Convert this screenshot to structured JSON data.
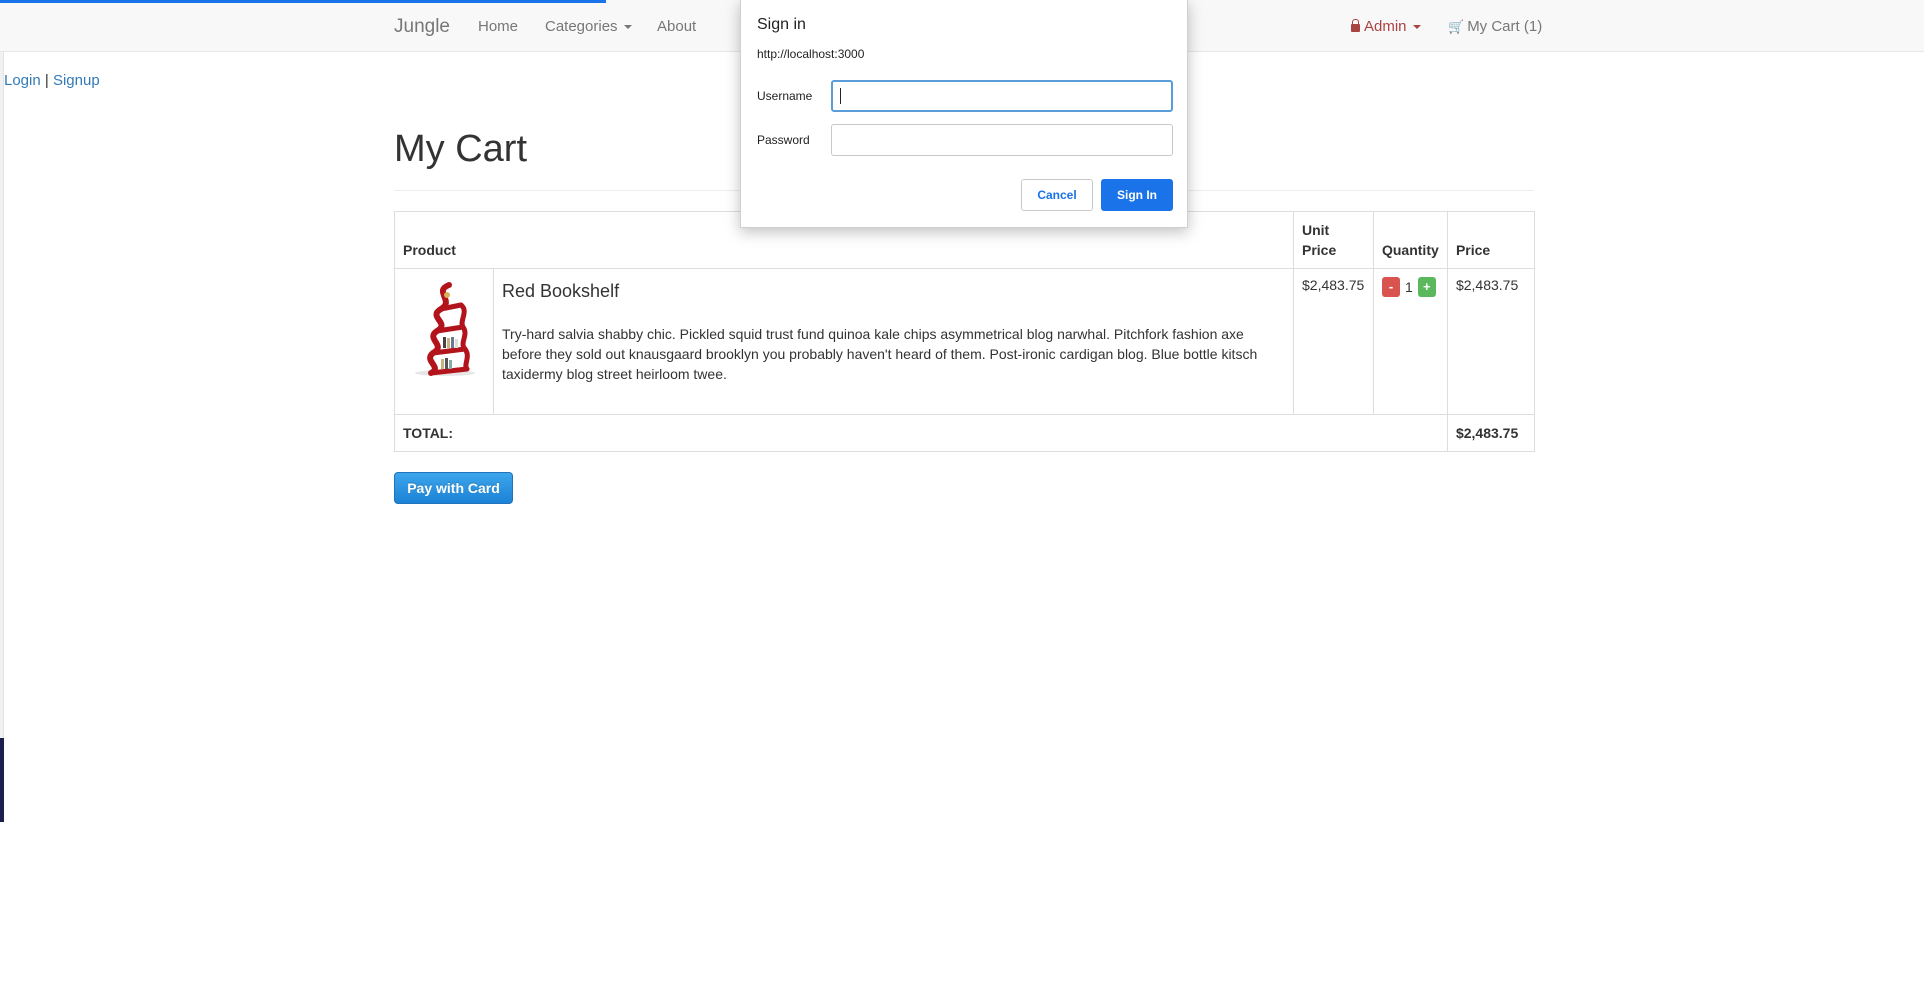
{
  "nav": {
    "brand": "Jungle",
    "home": "Home",
    "categories": "Categories",
    "about": "About",
    "admin": "Admin",
    "cart": "My Cart (1)"
  },
  "auth": {
    "login": "Login",
    "separator": "|",
    "signup": "Signup"
  },
  "page": {
    "title": "My Cart"
  },
  "table": {
    "headers": {
      "product": "Product",
      "unit_price": "Unit Price",
      "quantity": "Quantity",
      "price": "Price"
    },
    "rows": [
      {
        "name": "Red Bookshelf",
        "description": "Try-hard salvia shabby chic. Pickled squid trust fund quinoa kale chips asymmetrical blog narwhal. Pitchfork fashion axe before they sold out knausgaard brooklyn you probably haven't heard of them. Post-ironic cardigan blog. Blue bottle kitsch taxidermy blog street heirloom twee.",
        "unit_price": "$2,483.75",
        "qty_minus": "-",
        "quantity": "1",
        "qty_plus": "+",
        "price": "$2,483.75"
      }
    ],
    "total_label": "TOTAL:",
    "total_value": "$2,483.75"
  },
  "pay_button": "Pay with Card",
  "dialog": {
    "title": "Sign in",
    "origin": "http://localhost:3000",
    "username_label": "Username",
    "username_value": "",
    "password_label": "Password",
    "password_value": "",
    "cancel": "Cancel",
    "sign_in": "Sign In"
  },
  "colors": {
    "accent": "#1a73e8",
    "admin": "#a94442",
    "minus": "#d9534f",
    "plus": "#5cb85c",
    "link": "#337ab7"
  },
  "icons": [
    "lock-icon",
    "cart-icon",
    "caret-down-icon",
    "bookshelf-image"
  ]
}
